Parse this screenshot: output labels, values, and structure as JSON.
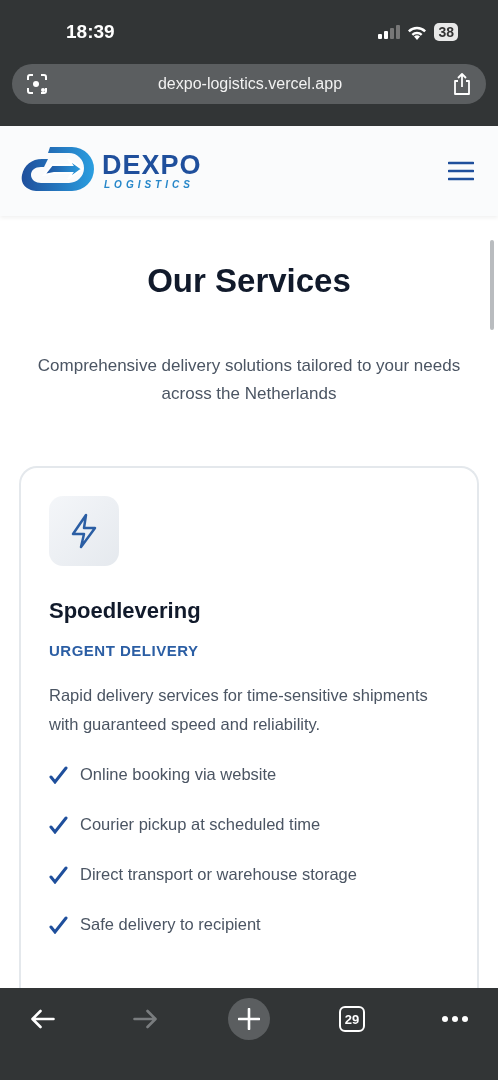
{
  "status_bar": {
    "time": "18:39",
    "battery": "38"
  },
  "browser": {
    "url": "dexpo-logistics.vercel.app"
  },
  "header": {
    "brand": "DEXPO",
    "tagline": "LOGISTICS"
  },
  "section": {
    "title": "Our Services",
    "subtitle": "Comprehensive delivery solutions tailored to your needs across the Netherlands"
  },
  "service": {
    "title": "Spoedlevering",
    "label": "URGENT DELIVERY",
    "description": "Rapid delivery services for time-sensitive shipments with guaranteed speed and reliability.",
    "features": [
      "Online booking via website",
      "Courier pickup at scheduled time",
      "Direct transport or warehouse storage",
      "Safe delivery to recipient"
    ]
  },
  "toolbar": {
    "back_disabled": false,
    "forward_disabled": true,
    "tab_count": "29"
  }
}
